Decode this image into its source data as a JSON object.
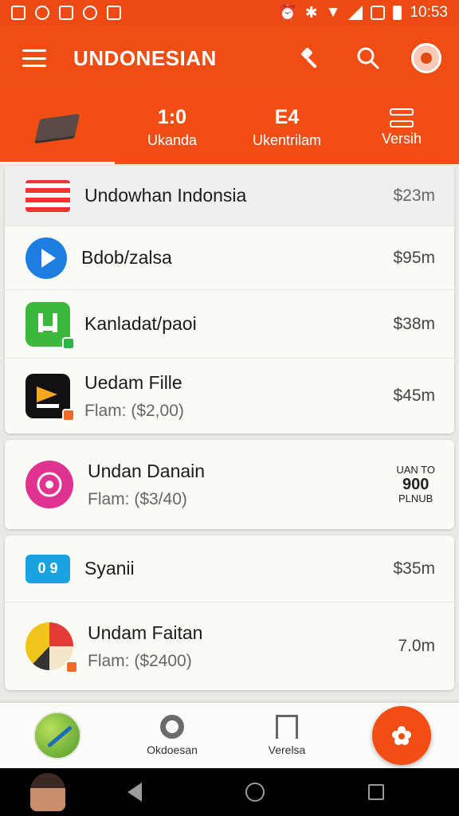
{
  "status_bar": {
    "time": "10:53"
  },
  "app_bar": {
    "title": "UNDONESIAN"
  },
  "tabs": [
    {
      "big": "",
      "label": ""
    },
    {
      "big": "1:0",
      "label": "Ukanda"
    },
    {
      "big": "E4",
      "label": "Ukentrilam"
    },
    {
      "big": "",
      "label": "Versih"
    }
  ],
  "list": {
    "card1": [
      {
        "name": "Undowhan Indonsia",
        "price": "$23m"
      },
      {
        "name": "Bdob/zalsa",
        "price": "$95m"
      },
      {
        "name": "Kanladat/paoi",
        "price": "$38m"
      },
      {
        "name": "Uedam Fille",
        "sub": "Flam: ($2,00)",
        "price": "$45m"
      }
    ],
    "card2": [
      {
        "name": "Undan Danain",
        "sub": "Flam: ($3/40)",
        "price_top": "UAN TO",
        "price_main": "900",
        "price_bottom": "PLNUB"
      }
    ],
    "card3": [
      {
        "name": "Syanii",
        "price": "$35m",
        "icon_text": "0 9"
      },
      {
        "name": "Undam Faitan",
        "sub": "Flam: ($2400)",
        "price": "7.0m"
      }
    ]
  },
  "bottom_nav": {
    "item2": "Okdoesan",
    "item3": "Verelsa"
  },
  "colors": {
    "primary": "#f04d14",
    "background": "#e9e9e6"
  }
}
